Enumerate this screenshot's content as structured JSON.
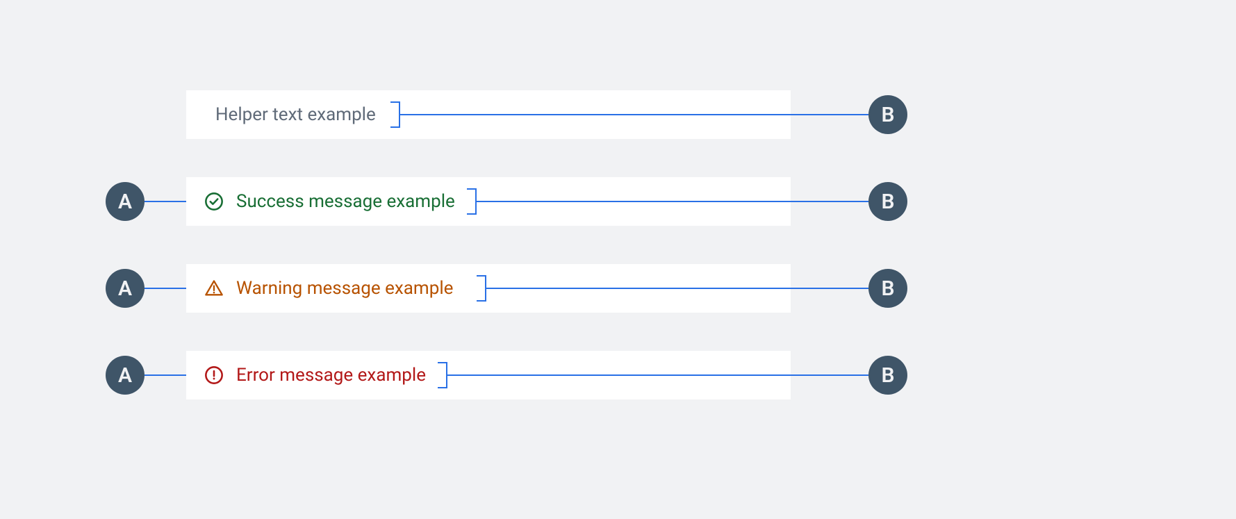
{
  "badges": {
    "a": "A",
    "b": "B"
  },
  "rows": [
    {
      "type": "helper",
      "text": "Helper text example",
      "show_a": false,
      "show_icon": false
    },
    {
      "type": "success",
      "text": "Success message example",
      "show_a": true,
      "show_icon": true
    },
    {
      "type": "warning",
      "text": "Warning message example",
      "show_a": true,
      "show_icon": true
    },
    {
      "type": "error",
      "text": "Error message example",
      "show_a": true,
      "show_icon": true
    }
  ],
  "colors": {
    "annotation_line": "#2970e6",
    "badge_bg": "#3f5568",
    "helper": "#5f6a78",
    "success": "#186e34",
    "warning": "#b75200",
    "error": "#b21818"
  }
}
